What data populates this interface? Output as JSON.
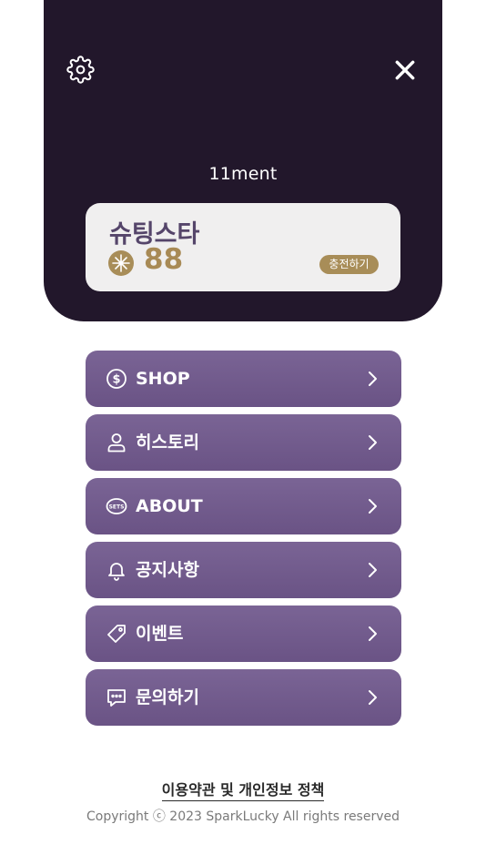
{
  "header": {
    "username": "11ment",
    "card": {
      "title": "슈팅스타",
      "coins": "88",
      "charge_label": "충전하기"
    }
  },
  "menu": {
    "items": [
      {
        "label": "SHOP",
        "icon": "dollar-icon"
      },
      {
        "label": "히스토리",
        "icon": "user-icon"
      },
      {
        "label": "ABOUT",
        "icon": "sets-icon"
      },
      {
        "label": "공지사항",
        "icon": "bell-icon"
      },
      {
        "label": "이벤트",
        "icon": "tag-icon"
      },
      {
        "label": "문의하기",
        "icon": "chat-icon"
      }
    ]
  },
  "footer": {
    "terms": "이용약관 및 개인정보 정책",
    "copyright": "Copyright ⓒ 2023 SparkLucky All rights reserved"
  },
  "colors": {
    "header_bg": "#22172b",
    "menu_bg": "#735d8e",
    "accent_gold": "#a88d58",
    "card_title": "#55456a"
  }
}
